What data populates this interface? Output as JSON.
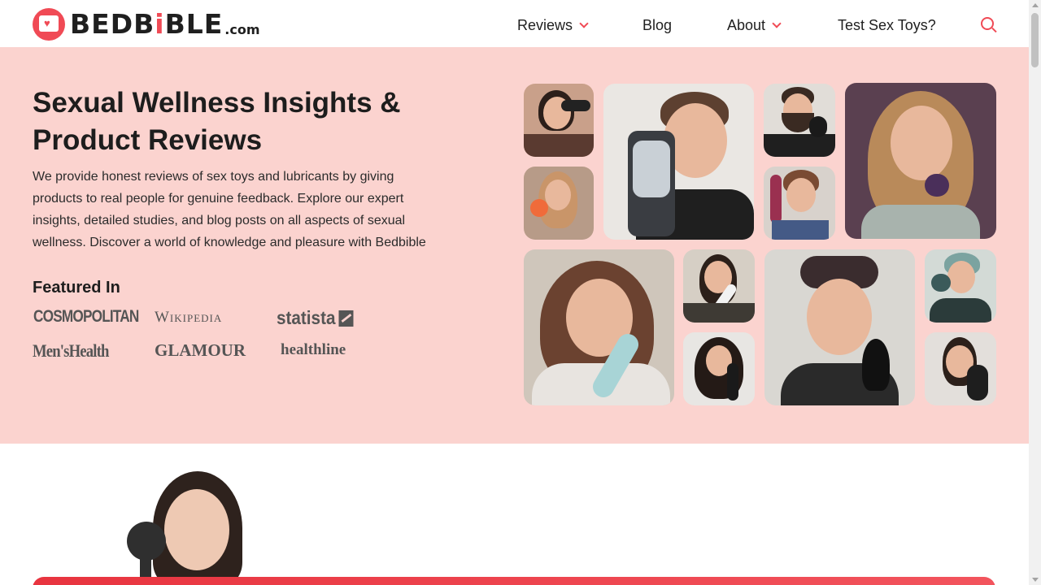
{
  "header": {
    "logo": {
      "brand_start": "BEDB",
      "brand_accent": "i",
      "brand_end": "BLE",
      "suffix": ".com"
    },
    "nav": [
      {
        "label": "Reviews",
        "has_dropdown": true
      },
      {
        "label": "Blog",
        "has_dropdown": false
      },
      {
        "label": "About",
        "has_dropdown": true
      },
      {
        "label": "Test Sex Toys?",
        "has_dropdown": false
      }
    ],
    "search_icon": "search-icon"
  },
  "hero": {
    "title": "Sexual Wellness Insights & Product Reviews",
    "description": "We provide honest reviews of sex toys and lubricants by giving products to real people for genuine feedback. Explore our expert insights, detailed studies, and blog posts on all aspects of sexual wellness. Discover a world of knowledge and pleasure with Bedbible",
    "featured_title": "Featured In",
    "publications": [
      "COSMOPOLITAN",
      "Wikipedia",
      "statista",
      "Men'sHealth",
      "GLAMOUR",
      "healthline"
    ]
  },
  "colors": {
    "accent": "#f04a55",
    "hero_bg": "#fbd3cf",
    "cta_bar": "#e8343f"
  }
}
